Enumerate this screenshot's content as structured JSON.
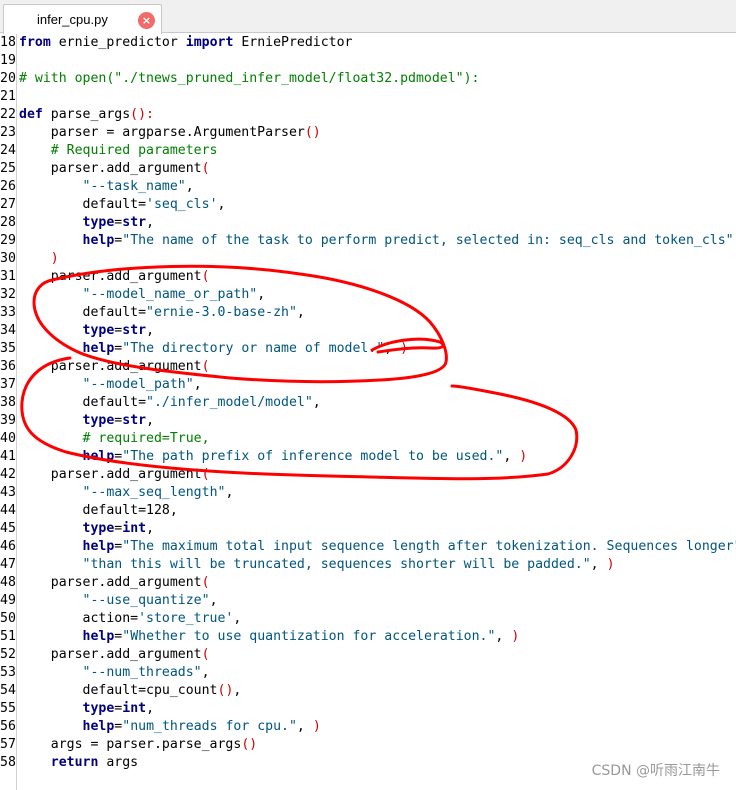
{
  "tab": {
    "filename": "infer_cpu.py",
    "close_glyph": "×"
  },
  "watermark": "CSDN @听雨江南牛",
  "lines": [
    {
      "n": "18",
      "t": [
        [
          "kw",
          "from"
        ],
        [
          "txt",
          " ernie_predictor "
        ],
        [
          "kw",
          "import"
        ],
        [
          "txt",
          " ErniePredictor"
        ]
      ]
    },
    {
      "n": "19",
      "t": []
    },
    {
      "n": "20",
      "t": [
        [
          "cmt",
          "# with open(\"./tnews_pruned_infer_model/float32.pdmodel\"):"
        ]
      ]
    },
    {
      "n": "21",
      "t": []
    },
    {
      "n": "22",
      "t": [
        [
          "kw",
          "def"
        ],
        [
          "txt",
          " parse_args"
        ],
        [
          "par",
          "():"
        ]
      ]
    },
    {
      "n": "23",
      "t": [
        [
          "txt",
          "    parser = argparse.ArgumentParser"
        ],
        [
          "par",
          "()"
        ]
      ]
    },
    {
      "n": "24",
      "t": [
        [
          "cmt",
          "    # Required parameters"
        ]
      ]
    },
    {
      "n": "25",
      "t": [
        [
          "txt",
          "    parser.add_argument"
        ],
        [
          "par",
          "("
        ]
      ]
    },
    {
      "n": "26",
      "t": [
        [
          "txt",
          "        "
        ],
        [
          "str",
          "\"--task_name\""
        ],
        [
          "txt",
          ","
        ]
      ]
    },
    {
      "n": "27",
      "t": [
        [
          "txt",
          "        default="
        ],
        [
          "str",
          "'seq_cls'"
        ],
        [
          "txt",
          ","
        ]
      ]
    },
    {
      "n": "28",
      "t": [
        [
          "txt",
          "        "
        ],
        [
          "kw",
          "type"
        ],
        [
          "txt",
          "="
        ],
        [
          "kw",
          "str"
        ],
        [
          "txt",
          ","
        ]
      ]
    },
    {
      "n": "29",
      "t": [
        [
          "txt",
          "        "
        ],
        [
          "kw",
          "help"
        ],
        [
          "txt",
          "="
        ],
        [
          "str",
          "\"The name of the task to perform predict, selected in: seq_cls and token_cls\""
        ]
      ]
    },
    {
      "n": "30",
      "t": [
        [
          "par",
          "    )"
        ]
      ]
    },
    {
      "n": "31",
      "t": [
        [
          "txt",
          "    parser.add_argument"
        ],
        [
          "par",
          "("
        ]
      ]
    },
    {
      "n": "32",
      "t": [
        [
          "txt",
          "        "
        ],
        [
          "str",
          "\"--model_name_or_path\""
        ],
        [
          "txt",
          ","
        ]
      ]
    },
    {
      "n": "33",
      "t": [
        [
          "txt",
          "        default="
        ],
        [
          "str",
          "\"ernie-3.0-base-zh\""
        ],
        [
          "txt",
          ","
        ]
      ]
    },
    {
      "n": "34",
      "t": [
        [
          "txt",
          "        "
        ],
        [
          "kw",
          "type"
        ],
        [
          "txt",
          "="
        ],
        [
          "kw",
          "str"
        ],
        [
          "txt",
          ","
        ]
      ]
    },
    {
      "n": "35",
      "t": [
        [
          "txt",
          "        "
        ],
        [
          "kw",
          "help"
        ],
        [
          "txt",
          "="
        ],
        [
          "str",
          "\"The directory or name of model.\""
        ],
        [
          "txt",
          ", "
        ],
        [
          "par",
          ")"
        ]
      ]
    },
    {
      "n": "36",
      "t": [
        [
          "txt",
          "    parser.add_argument"
        ],
        [
          "par",
          "("
        ]
      ]
    },
    {
      "n": "37",
      "t": [
        [
          "txt",
          "        "
        ],
        [
          "str",
          "\"--model_path\""
        ],
        [
          "txt",
          ","
        ]
      ]
    },
    {
      "n": "38",
      "t": [
        [
          "txt",
          "        default="
        ],
        [
          "str",
          "\"./infer_model/model\""
        ],
        [
          "txt",
          ","
        ]
      ]
    },
    {
      "n": "39",
      "t": [
        [
          "txt",
          "        "
        ],
        [
          "kw",
          "type"
        ],
        [
          "txt",
          "="
        ],
        [
          "kw",
          "str"
        ],
        [
          "txt",
          ","
        ]
      ]
    },
    {
      "n": "40",
      "t": [
        [
          "cmt",
          "        # required=True,"
        ]
      ]
    },
    {
      "n": "41",
      "t": [
        [
          "txt",
          "        "
        ],
        [
          "kw",
          "help"
        ],
        [
          "txt",
          "="
        ],
        [
          "str",
          "\"The path prefix of inference model to be used.\""
        ],
        [
          "txt",
          ", "
        ],
        [
          "par",
          ")"
        ]
      ]
    },
    {
      "n": "42",
      "t": [
        [
          "txt",
          "    parser.add_argument"
        ],
        [
          "par",
          "("
        ]
      ]
    },
    {
      "n": "43",
      "t": [
        [
          "txt",
          "        "
        ],
        [
          "str",
          "\"--max_seq_length\""
        ],
        [
          "txt",
          ","
        ]
      ]
    },
    {
      "n": "44",
      "t": [
        [
          "txt",
          "        default=128,"
        ]
      ]
    },
    {
      "n": "45",
      "t": [
        [
          "txt",
          "        "
        ],
        [
          "kw",
          "type"
        ],
        [
          "txt",
          "="
        ],
        [
          "kw",
          "int"
        ],
        [
          "txt",
          ","
        ]
      ]
    },
    {
      "n": "46",
      "t": [
        [
          "txt",
          "        "
        ],
        [
          "kw",
          "help"
        ],
        [
          "txt",
          "="
        ],
        [
          "str",
          "\"The maximum total input sequence length after tokenization. Sequences longer\""
        ]
      ]
    },
    {
      "n": "47",
      "t": [
        [
          "txt",
          "        "
        ],
        [
          "str",
          "\"than this will be truncated, sequences shorter will be padded.\""
        ],
        [
          "txt",
          ", "
        ],
        [
          "par",
          ")"
        ]
      ]
    },
    {
      "n": "48",
      "t": [
        [
          "txt",
          "    parser.add_argument"
        ],
        [
          "par",
          "("
        ]
      ]
    },
    {
      "n": "49",
      "t": [
        [
          "txt",
          "        "
        ],
        [
          "str",
          "\"--use_quantize\""
        ],
        [
          "txt",
          ","
        ]
      ]
    },
    {
      "n": "50",
      "t": [
        [
          "txt",
          "        action="
        ],
        [
          "str",
          "'store_true'"
        ],
        [
          "txt",
          ","
        ]
      ]
    },
    {
      "n": "51",
      "t": [
        [
          "txt",
          "        "
        ],
        [
          "kw",
          "help"
        ],
        [
          "txt",
          "="
        ],
        [
          "str",
          "\"Whether to use quantization for acceleration.\""
        ],
        [
          "txt",
          ", "
        ],
        [
          "par",
          ")"
        ]
      ]
    },
    {
      "n": "52",
      "t": [
        [
          "txt",
          "    parser.add_argument"
        ],
        [
          "par",
          "("
        ]
      ]
    },
    {
      "n": "53",
      "t": [
        [
          "txt",
          "        "
        ],
        [
          "str",
          "\"--num_threads\""
        ],
        [
          "txt",
          ","
        ]
      ]
    },
    {
      "n": "54",
      "t": [
        [
          "txt",
          "        default=cpu_count"
        ],
        [
          "par",
          "()"
        ],
        [
          "txt",
          ","
        ]
      ]
    },
    {
      "n": "55",
      "t": [
        [
          "txt",
          "        "
        ],
        [
          "kw",
          "type"
        ],
        [
          "txt",
          "="
        ],
        [
          "kw",
          "int"
        ],
        [
          "txt",
          ","
        ]
      ]
    },
    {
      "n": "56",
      "t": [
        [
          "txt",
          "        "
        ],
        [
          "kw",
          "help"
        ],
        [
          "txt",
          "="
        ],
        [
          "str",
          "\"num_threads for cpu.\""
        ],
        [
          "txt",
          ", "
        ],
        [
          "par",
          ")"
        ]
      ]
    },
    {
      "n": "57",
      "t": [
        [
          "txt",
          "    args = parser.parse_args"
        ],
        [
          "par",
          "()"
        ]
      ]
    },
    {
      "n": "58",
      "t": [
        [
          "txt",
          "    "
        ],
        [
          "kw",
          "return"
        ],
        [
          "txt",
          " args"
        ]
      ]
    }
  ],
  "colors": {
    "keyword": "#00007f",
    "string": "#00557f",
    "comment": "#007f00",
    "paren": "#d40000",
    "annotation": "#ff0000"
  }
}
